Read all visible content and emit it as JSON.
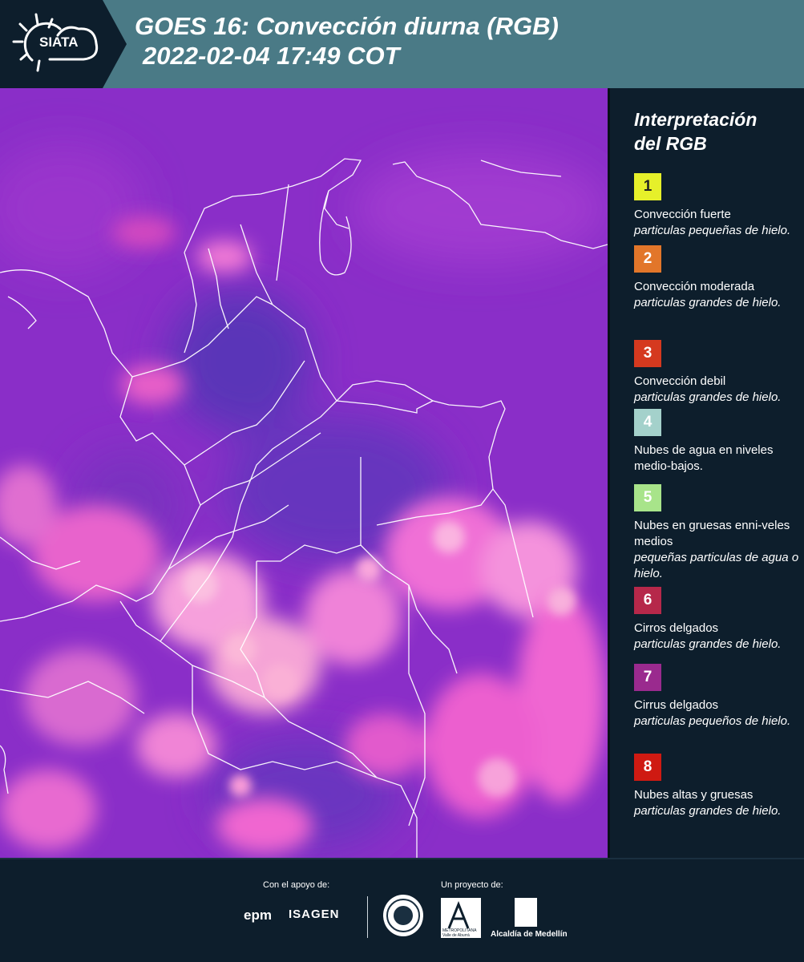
{
  "header": {
    "logo_text": "SIATA",
    "title_line1": "GOES 16: Convección diurna (RGB)",
    "title_line2": "2022-02-04 17:49 COT"
  },
  "legend": {
    "title_line1": "Interpretación",
    "title_line2": "del RGB",
    "items": [
      {
        "number": "1",
        "color": "#e6f02a",
        "text_color": "#222222",
        "name": "Convección fuerte",
        "desc": "particulas pequeñas de hielo."
      },
      {
        "number": "2",
        "color": "#e2762a",
        "text_color": "#ffffff",
        "name": "Convección moderada",
        "desc": "particulas grandes de hielo."
      },
      {
        "number": "3",
        "color": "#d5391f",
        "text_color": "#ffffff",
        "name": "Convección debil",
        "desc": "particulas grandes de hielo."
      },
      {
        "number": "4",
        "color": "#a4d1cb",
        "text_color": "#ffffff",
        "name": "Nubes de agua en niveles medio-bajos.",
        "desc": ""
      },
      {
        "number": "5",
        "color": "#a8e48a",
        "text_color": "#ffffff",
        "name": "Nubes en gruesas enni-veles medios",
        "desc": "pequeñas particulas de agua o hielo."
      },
      {
        "number": "6",
        "color": "#b6284a",
        "text_color": "#ffffff",
        "name": "Cirros delgados",
        "desc": "particulas grandes de hielo."
      },
      {
        "number": "7",
        "color": "#9a2a8e",
        "text_color": "#ffffff",
        "name": "Cirrus delgados",
        "desc": "particulas pequeños de hielo."
      },
      {
        "number": "8",
        "color": "#cf1a12",
        "text_color": "#ffffff",
        "name": "Nubes altas y gruesas",
        "desc": "particulas grandes de hielo."
      }
    ]
  },
  "footer": {
    "support_label": "Con el apoyo de:",
    "project_label": "Un proyecto de:",
    "sponsor1": "epm",
    "sponsor2": "ISAGEN",
    "partner_area": "METROPOLITANA Valle de Aburrá",
    "partner_alcaldia": "Alcaldía de Medellín"
  }
}
